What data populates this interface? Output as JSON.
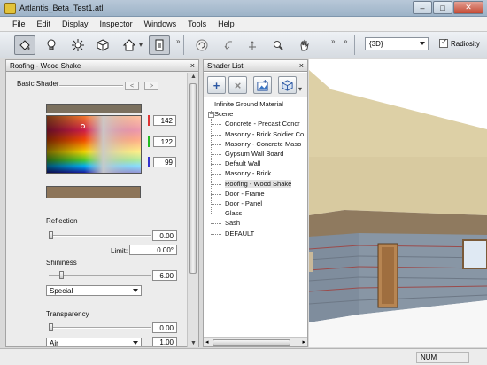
{
  "window": {
    "title": "Artlantis_Beta_Test1.atl",
    "minimize": "–",
    "maximize": "□",
    "close": "✕"
  },
  "menu": [
    "File",
    "Edit",
    "Display",
    "Inspector",
    "Windows",
    "Tools",
    "Help"
  ],
  "toolbar": {
    "tools": [
      "shader-tool",
      "light-tool",
      "sun-tool",
      "object-tool",
      "perspective-tool",
      "document-tool",
      "render-tool",
      "undo-tool",
      "redo-tool",
      "zoom-tool",
      "pan-tool"
    ],
    "more": "»",
    "view_select": "{3D}",
    "radiosity_label": "Radiosity",
    "radiosity_checked": true
  },
  "inspector": {
    "title": "Roofing - Wood Shake",
    "shader_label": "Basic Shader",
    "prev": "<",
    "next": ">",
    "color": {
      "r": "142",
      "g": "122",
      "b": "99",
      "swatch": "#8d7559"
    },
    "reflection": {
      "label": "Reflection",
      "value": "0.00",
      "limit_label": "Limit:",
      "limit_value": "0.00°"
    },
    "shininess": {
      "label": "Shininess",
      "value": "6.00",
      "mode": "Special"
    },
    "transparency": {
      "label": "Transparency",
      "value": "0.00",
      "medium": "Air",
      "ior": "1.00"
    }
  },
  "shader_list": {
    "title": "Shader List",
    "buttons": [
      "+",
      "×"
    ],
    "items": [
      {
        "label": "Infinite Ground Material",
        "level": 0
      },
      {
        "label": "Scene",
        "level": 0,
        "expander": "−"
      },
      {
        "label": "Concrete - Precast Concr",
        "level": 1
      },
      {
        "label": "Masonry - Brick Soldier Co",
        "level": 1
      },
      {
        "label": "Masonry - Concrete Maso",
        "level": 1
      },
      {
        "label": "Gypsum Wall Board",
        "level": 1
      },
      {
        "label": "Default Wall",
        "level": 1
      },
      {
        "label": "Masonry - Brick",
        "level": 1
      },
      {
        "label": "Roofing - Wood Shake",
        "level": 1,
        "selected": true
      },
      {
        "label": "Door - Frame",
        "level": 1
      },
      {
        "label": "Door - Panel",
        "level": 1
      },
      {
        "label": "Glass",
        "level": 1
      },
      {
        "label": "Sash",
        "level": 1
      },
      {
        "label": "DEFAULT",
        "level": 1
      }
    ]
  },
  "status": {
    "num": "NUM"
  },
  "colors": {
    "roof": "#ddd0a6",
    "wall_upper": "#8f7a5f",
    "wall_lower": "#7f8d9d",
    "door": "#b78552"
  }
}
